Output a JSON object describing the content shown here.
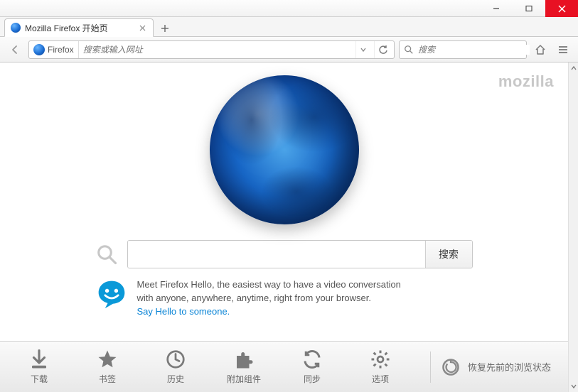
{
  "window": {
    "tab_title": "Mozilla Firefox 开始页"
  },
  "navbar": {
    "brand_pill": "Firefox",
    "url_placeholder": "搜索或输入网址",
    "search_placeholder": "搜索"
  },
  "page": {
    "mozilla_wordmark": "mozilla",
    "search_button": "搜索",
    "hello_line1": "Meet Firefox Hello, the easiest way to have a video conversation",
    "hello_line2": "with anyone, anywhere, anytime, right from your browser.",
    "hello_link": "Say Hello to someone."
  },
  "launch": {
    "items": [
      {
        "label": "下载"
      },
      {
        "label": "书签"
      },
      {
        "label": "历史"
      },
      {
        "label": "附加组件"
      },
      {
        "label": "同步"
      },
      {
        "label": "选项"
      }
    ],
    "restore": "恢复先前的浏览状态"
  }
}
